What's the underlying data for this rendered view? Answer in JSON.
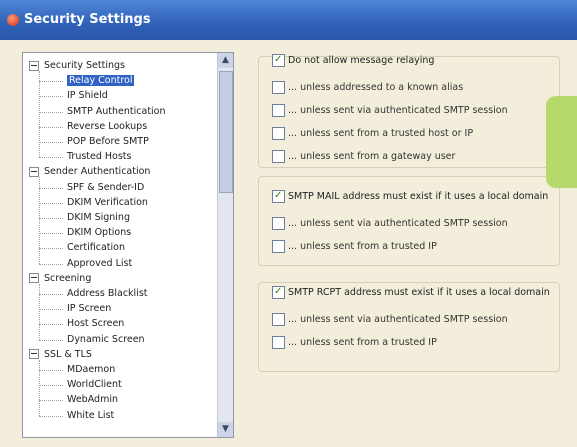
{
  "window": {
    "title": "Security Settings"
  },
  "tree": {
    "items": [
      {
        "label": "Security Settings",
        "level": 0,
        "expander": true
      },
      {
        "label": "Relay Control",
        "level": 1,
        "selected": true
      },
      {
        "label": "IP Shield",
        "level": 1
      },
      {
        "label": "SMTP Authentication",
        "level": 1
      },
      {
        "label": "Reverse Lookups",
        "level": 1
      },
      {
        "label": "POP Before SMTP",
        "level": 1
      },
      {
        "label": "Trusted Hosts",
        "level": 1
      },
      {
        "label": "Sender Authentication",
        "level": 0,
        "expander": true
      },
      {
        "label": "SPF & Sender-ID",
        "level": 1
      },
      {
        "label": "DKIM Verification",
        "level": 1
      },
      {
        "label": "DKIM Signing",
        "level": 1
      },
      {
        "label": "DKIM Options",
        "level": 1
      },
      {
        "label": "Certification",
        "level": 1
      },
      {
        "label": "Approved List",
        "level": 1
      },
      {
        "label": "Screening",
        "level": 0,
        "expander": true
      },
      {
        "label": "Address Blacklist",
        "level": 1
      },
      {
        "label": "IP Screen",
        "level": 1
      },
      {
        "label": "Host Screen",
        "level": 1
      },
      {
        "label": "Dynamic Screen",
        "level": 1
      },
      {
        "label": "SSL & TLS",
        "level": 0,
        "expander": true
      },
      {
        "label": "MDaemon",
        "level": 1
      },
      {
        "label": "WorldClient",
        "level": 1
      },
      {
        "label": "WebAdmin",
        "level": 1
      },
      {
        "label": "White List",
        "level": 1
      }
    ],
    "scroll_up_icon": "up-arrow",
    "scroll_down_icon": "down-arrow"
  },
  "groups": [
    {
      "main": {
        "label": "Do not allow message relaying",
        "checked": true
      },
      "options": [
        {
          "label": "... unless addressed to a known alias",
          "checked": false
        },
        {
          "label": "... unless sent via authenticated SMTP session",
          "checked": false
        },
        {
          "label": "... unless sent from a trusted host or IP",
          "checked": false
        },
        {
          "label": "... unless sent from a gateway user",
          "checked": false
        }
      ]
    },
    {
      "main": {
        "label": "SMTP MAIL address must exist if it uses a local domain",
        "checked": true
      },
      "options": [
        {
          "label": "... unless sent via authenticated SMTP session",
          "checked": false
        },
        {
          "label": "... unless sent from a trusted IP",
          "checked": false
        }
      ]
    },
    {
      "main": {
        "label": "SMTP RCPT address must exist if it uses a local domain",
        "checked": true
      },
      "options": [
        {
          "label": "... unless sent via authenticated SMTP session",
          "checked": false
        },
        {
          "label": "... unless sent from a trusted IP",
          "checked": false
        }
      ]
    }
  ],
  "colors": {
    "accent": "#2f62c4",
    "titlebar": "#2f61b8",
    "background": "#f2eedb",
    "highlight_panel": "#b7d86a"
  }
}
